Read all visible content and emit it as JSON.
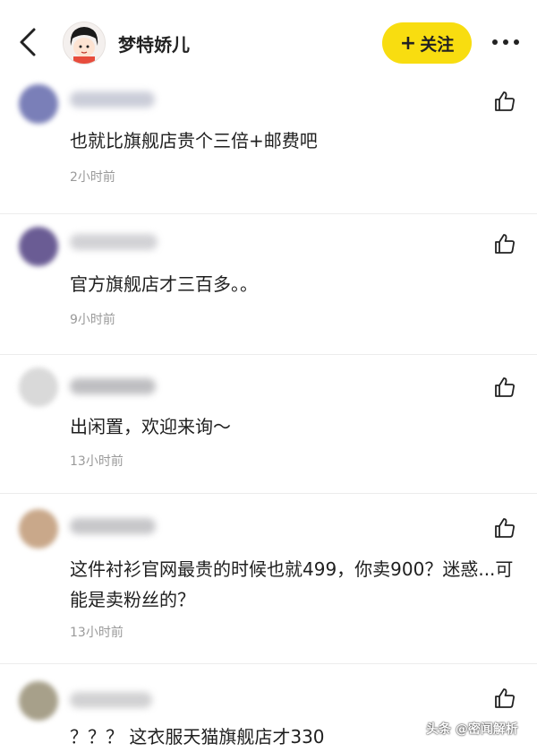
{
  "header": {
    "username": "梦特娇儿",
    "follow_label": "关注"
  },
  "comments": [
    {
      "text": "也就比旗舰店贵个三倍+邮费吧",
      "time": "2小时前"
    },
    {
      "text": "官方旗舰店才三百多。。",
      "time": "9小时前"
    },
    {
      "text": "出闲置，欢迎来询～",
      "time": "13小时前"
    },
    {
      "text": "这件衬衫官网最贵的时候也就499，你卖900？迷惑...可能是卖粉丝的？",
      "time": "13小时前"
    },
    {
      "text": "？？？ 这衣服天猫旗舰店才330",
      "time": ""
    }
  ],
  "watermark": "头条 @密闻解析",
  "colors": {
    "follow_button": "#f8dd10",
    "time_text": "#9a9a9a"
  }
}
